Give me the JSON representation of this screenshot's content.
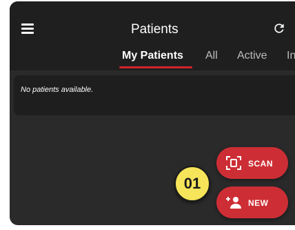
{
  "header": {
    "title": "Patients",
    "menu_icon": "hamburger-menu-icon",
    "refresh_icon": "refresh-icon"
  },
  "tabs": [
    {
      "label": "My Patients",
      "active": true
    },
    {
      "label": "All",
      "active": false
    },
    {
      "label": "Active",
      "active": false
    },
    {
      "label": "In",
      "active": false
    }
  ],
  "content": {
    "empty_message": "No patients available."
  },
  "actions": {
    "scan_label": "SCAN",
    "scan_icon": "qr-scan-icon",
    "new_label": "NEW",
    "new_icon": "add-person-icon"
  },
  "step_badge": "01",
  "colors": {
    "accent": "#d3232b",
    "fab": "#cd2e35",
    "background": "#2a2a2a",
    "header": "#1f1f1f",
    "badge": "#f6e45a"
  }
}
